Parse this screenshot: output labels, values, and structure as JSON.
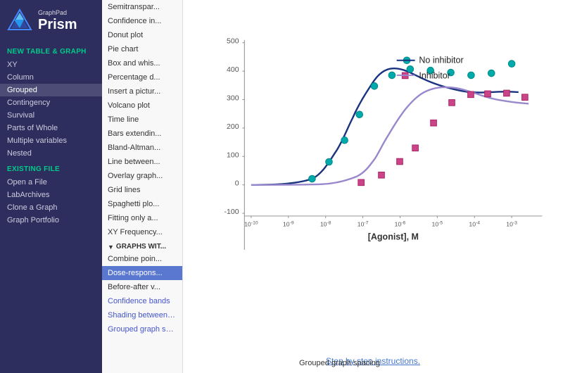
{
  "sidebar": {
    "logo": {
      "graphpad": "GraphPad",
      "prism": "Prism"
    },
    "new_table_section": "NEW TABLE & GRAPH",
    "new_table_items": [
      "XY",
      "Column",
      "Grouped",
      "Contingency",
      "Survival",
      "Parts of Whole",
      "Multiple variables",
      "Nested"
    ],
    "existing_file_section": "EXISTING FILE",
    "existing_file_items": [
      "Open a File",
      "LabArchives",
      "Clone a Graph",
      "Graph Portfolio"
    ]
  },
  "menu": {
    "items": [
      "Semitranspar...",
      "Confidence in...",
      "Donut plot",
      "Pie chart",
      "Box and whis...",
      "Percentage d...",
      "Insert a pictur...",
      "Volcano plot",
      "Time line",
      "Bars extendin...",
      "Bland-Altman...",
      "Line between...",
      "Overlay graph...",
      "Grid lines",
      "Spaghetti plo...",
      "Fitting only a...",
      "XY Frequency..."
    ],
    "graphs_with_section": "GRAPHS WIT...",
    "graphs_with_items": [
      "Combine poin...",
      "Dose-respons...",
      "Before-after v...",
      "Confidence bands",
      "Shading between grid lines",
      "Grouped graph spacing"
    ],
    "selected_item": "Dose-respons..."
  },
  "chart": {
    "title": "",
    "legend": {
      "series1": "No inhibitor",
      "series2": "Inhibitor"
    },
    "x_axis_label": "[Agonist], M",
    "x_axis_ticks": [
      "10⁻¹⁰",
      "10⁻⁹",
      "10⁻⁸",
      "10⁻⁷",
      "10⁻⁶",
      "10⁻⁵",
      "10⁻⁴",
      "10⁻³"
    ],
    "y_axis_ticks": [
      "-100",
      "0",
      "100",
      "200",
      "300",
      "400",
      "500"
    ],
    "step_link": "Step by step instructions."
  },
  "status_bar": {
    "text": "Grouped graph spacing"
  }
}
